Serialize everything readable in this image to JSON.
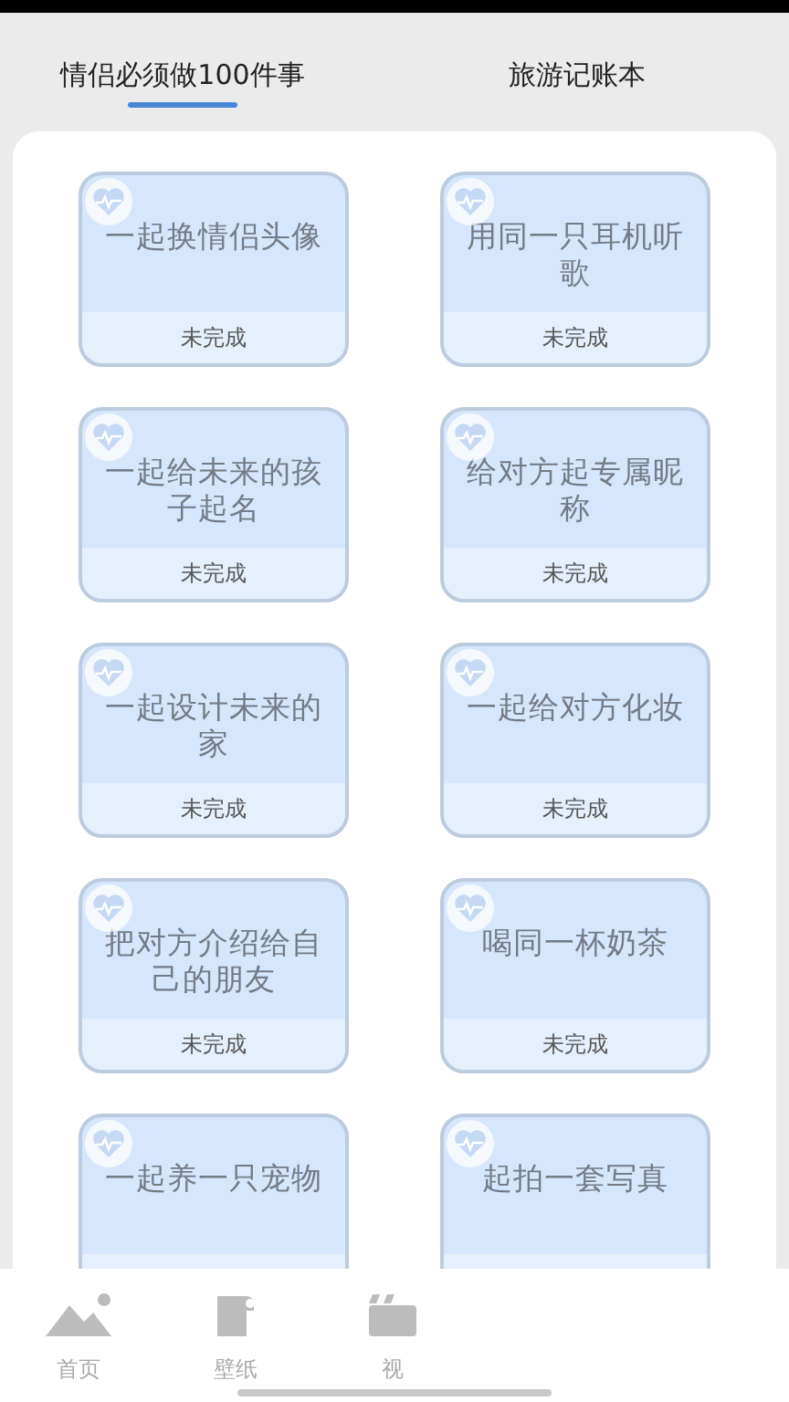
{
  "tabs": [
    {
      "label": "情侣必须做100件事",
      "selected": true
    },
    {
      "label": "旅游记账本",
      "selected": false
    }
  ],
  "cards": [
    {
      "title": "一起换情侣头像",
      "status": "未完成"
    },
    {
      "title": "用同一只耳机听歌",
      "status": "未完成"
    },
    {
      "title": "一起给未来的孩子起名",
      "status": "未完成"
    },
    {
      "title": "给对方起专属昵称",
      "status": "未完成"
    },
    {
      "title": "一起设计未来的家",
      "status": "未完成"
    },
    {
      "title": "一起给对方化妆",
      "status": "未完成"
    },
    {
      "title": "把对方介绍给自己的朋友",
      "status": "未完成"
    },
    {
      "title": "喝同一杯奶茶",
      "status": "未完成"
    },
    {
      "title": "一起养一只宠物"
    },
    {
      "title": "起拍一套写真"
    }
  ],
  "bottom_nav": [
    {
      "label": "首页",
      "kind": "mountain"
    },
    {
      "label": "壁纸",
      "kind": "paper"
    },
    {
      "label": "视",
      "kind": "film"
    }
  ]
}
